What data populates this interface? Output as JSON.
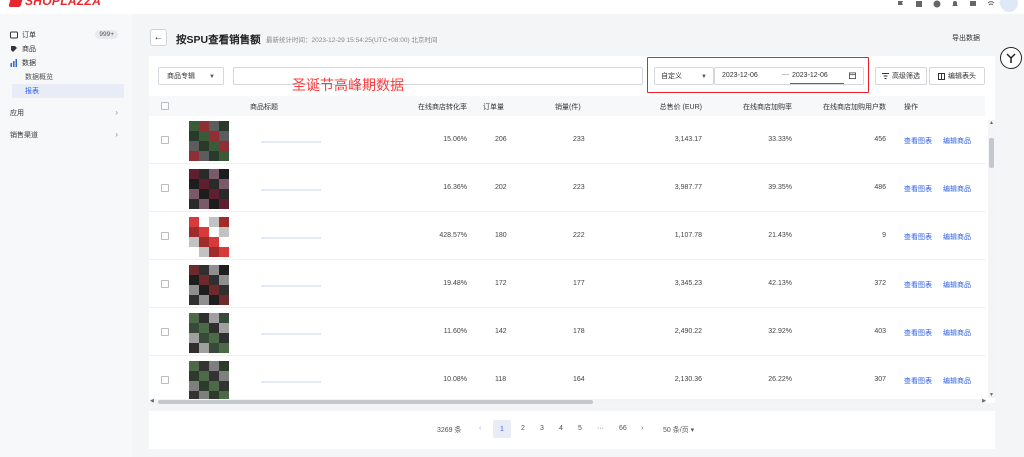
{
  "app": {
    "logo": "SHOPLAZZA"
  },
  "sidebar": {
    "orders_label": "订单",
    "orders_badge": "999+",
    "products_label": "商品",
    "data_label": "数据",
    "data_overview": "数据概览",
    "reports": "报表",
    "apps_label": "应用",
    "sales_channels_label": "销售渠道"
  },
  "header": {
    "title": "按SPU查看销售额",
    "last_updated": "最新统计时间：2023-12-29 15:54:25(UTC+08:00) 北京时间",
    "export": "导出数据"
  },
  "filters": {
    "product_select": "商品专辑",
    "search_value": "",
    "overlay_note": "圣诞节高峰期数据",
    "date_mode": "自定义",
    "date_start": "2023-12-06",
    "date_separator": "—",
    "date_end": "2023-12-06",
    "advanced_filter": "高级筛选",
    "edit_columns": "编辑表头"
  },
  "table": {
    "headers": {
      "title": "商品标题",
      "conversion": "在线商店转化率",
      "orders": "订单量",
      "units": "销量(件)",
      "total": "总售价 (EUR)",
      "add_to_cart_rate": "在线商店加购率",
      "add_to_cart_users": "在线商店加购用户数",
      "actions": "操作"
    },
    "rows": [
      {
        "conversion": "15.06%",
        "orders": "206",
        "units": "233",
        "total": "3,143.17",
        "cart_rate": "33.33%",
        "cart_users": "456"
      },
      {
        "conversion": "16.36%",
        "orders": "202",
        "units": "223",
        "total": "3,987.77",
        "cart_rate": "39.35%",
        "cart_users": "486"
      },
      {
        "conversion": "428.57%",
        "orders": "180",
        "units": "222",
        "total": "1,107.78",
        "cart_rate": "21.43%",
        "cart_users": "9"
      },
      {
        "conversion": "19.48%",
        "orders": "172",
        "units": "177",
        "total": "3,345.23",
        "cart_rate": "42.13%",
        "cart_users": "372"
      },
      {
        "conversion": "11.60%",
        "orders": "142",
        "units": "178",
        "total": "2,490.22",
        "cart_rate": "32.92%",
        "cart_users": "403"
      },
      {
        "conversion": "10.08%",
        "orders": "118",
        "units": "164",
        "total": "2,130.36",
        "cart_rate": "26.22%",
        "cart_users": "307"
      }
    ],
    "action_view_chart": "查看图表",
    "action_edit_product": "编辑商品"
  },
  "pagination": {
    "total": "3269 条",
    "pages": [
      "1",
      "2",
      "3",
      "4",
      "5"
    ],
    "ellipsis": "···",
    "last_page": "66",
    "page_size": "50 条/页"
  },
  "colors": {
    "accent": "#2f62e8",
    "brand": "#e6282e",
    "highlight_border": "#e8212b",
    "overlay_text": "#ff3b3b"
  }
}
